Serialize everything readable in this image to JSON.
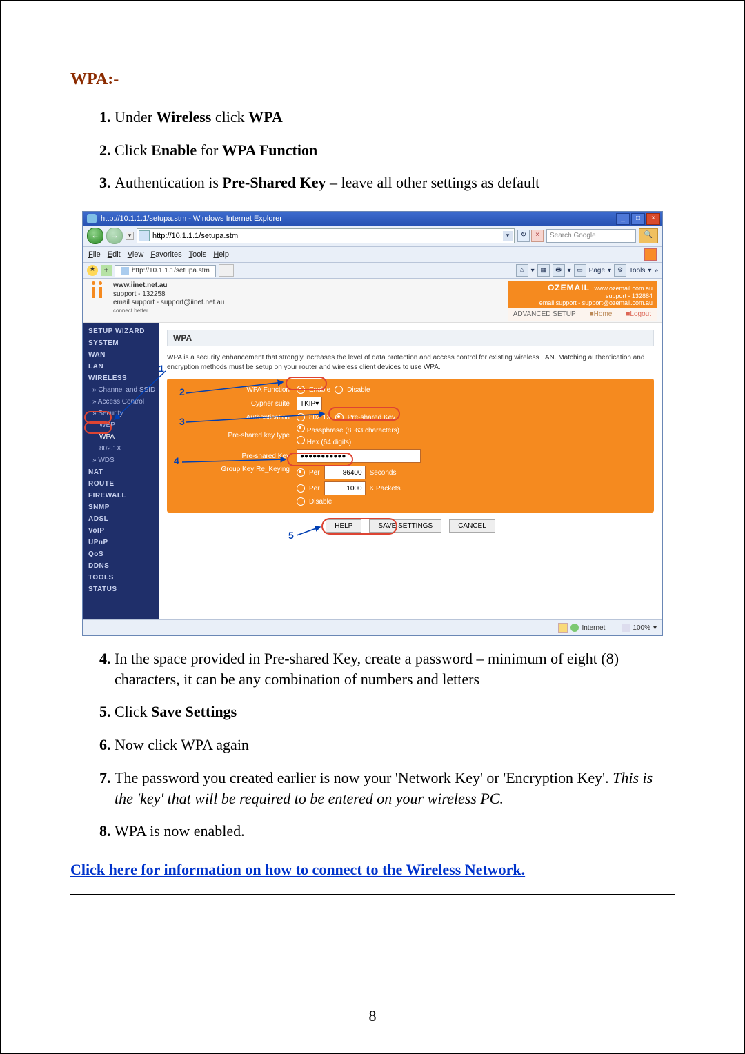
{
  "heading": "WPA:-",
  "steps_top": [
    {
      "n": "1)",
      "pre": "Under ",
      "b1": "Wireless",
      "mid": " click ",
      "b2": "WPA",
      "post": ""
    },
    {
      "n": "2)",
      "pre": "Click ",
      "b1": "Enable",
      "mid": " for ",
      "b2": "WPA Function",
      "post": ""
    },
    {
      "n": "3)",
      "pre": "Authentication is ",
      "b1": "Pre-Shared Key",
      "mid": "",
      "b2": "",
      "post": " – leave all other settings as default"
    }
  ],
  "ie": {
    "title": "http://10.1.1.1/setupa.stm - Windows Internet Explorer",
    "url": "http://10.1.1.1/setupa.stm",
    "search_placeholder": "Search Google",
    "menus": [
      "File",
      "Edit",
      "View",
      "Favorites",
      "Tools",
      "Help"
    ],
    "tab_label": "http://10.1.1.1/setupa.stm",
    "tool_page": "Page",
    "tool_tools": "Tools",
    "status_zone": "Internet",
    "status_zoom": "100%"
  },
  "router": {
    "iinet": {
      "site": "www.iinet.net.au",
      "support": "support - 132258",
      "email": "email support - support@iinet.net.au",
      "tag": "connect better"
    },
    "oz": {
      "brand": "OZEMAIL",
      "site": "www.ozemail.com.au",
      "support": "support - 132884",
      "email": "email support - support@ozemail.com.au"
    },
    "under": {
      "adv": "ADVANCED SETUP",
      "home": "■Home",
      "logout": "■Logout"
    },
    "side": [
      "SETUP WIZARD",
      "SYSTEM",
      "WAN",
      "LAN",
      "WIRELESS",
      "» Channel and SSID",
      "» Access Control",
      "» Security",
      "WEP",
      "WPA",
      "802.1X",
      "» WDS",
      "NAT",
      "ROUTE",
      "FIREWALL",
      "SNMP",
      "ADSL",
      "VoIP",
      "UPnP",
      "QoS",
      "DDNS",
      "TOOLS",
      "STATUS"
    ],
    "wpa_title": "WPA",
    "wpa_desc": "WPA is a security enhancement that strongly increases the level of data protection and access control for existing wireless LAN. Matching authentication and encryption methods must be setup on your router and wireless client devices to use WPA.",
    "labels": {
      "func": "WPA Function",
      "enable": "Enable",
      "disable": "Disable",
      "cypher": "Cypher suite",
      "cypher_v": "TKIP",
      "auth": "Authentication",
      "auth1": "802.1X",
      "auth2": "Pre-shared Key",
      "pktype": "Pre-shared key type",
      "pktype1": "Passphrase (8~63 characters)",
      "pktype2": "Hex (64 digits)",
      "pkey": "Pre-shared Key",
      "pkey_v": "●●●●●●●●●●●",
      "rekey": "Group Key Re_Keying",
      "rekey_per": "Per",
      "rekey_sec": "Seconds",
      "rekey_sec_v": "86400",
      "rekey_kp": "K Packets",
      "rekey_kp_v": "1000",
      "rekey_dis": "Disable"
    },
    "btns": {
      "help": "HELP",
      "save": "SAVE SETTINGS",
      "cancel": "CANCEL"
    }
  },
  "steps_bottom": [
    {
      "n": "4)",
      "html": "In the space provided in Pre-shared Key, create a password – minimum of eight (8) characters, it can be any combination of numbers and letters"
    },
    {
      "n": "5)",
      "html": "Click <b>Save Settings</b>"
    },
    {
      "n": "6)",
      "html": "Now click WPA again"
    },
    {
      "n": "7)",
      "html": "The password you created earlier is now your 'Network Key' or 'Encryption Key'. <i>This is the 'key' that will be required to be entered on your wireless PC.</i>"
    },
    {
      "n": "8)",
      "html": "WPA is now enabled."
    }
  ],
  "link_text": "Click here for information on how to connect to the Wireless Network.",
  "page_number": "8",
  "callouts": [
    "1",
    "2",
    "3",
    "4",
    "5"
  ]
}
